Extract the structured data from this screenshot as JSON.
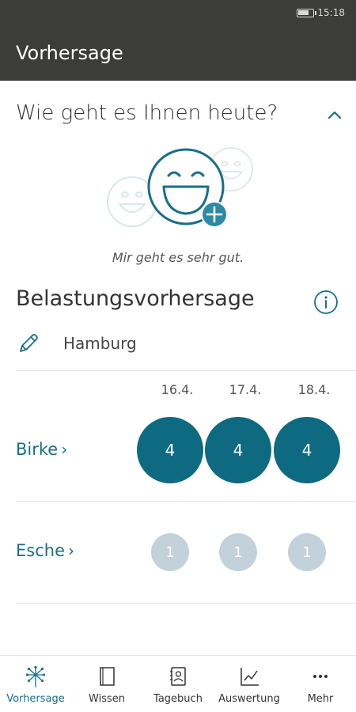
{
  "status_bar": {
    "time": "15:18"
  },
  "app_bar": {
    "title": "Vorhersage"
  },
  "mood": {
    "question": "Wie geht es Ihnen heute?",
    "caption": "Mir geht es sehr gut."
  },
  "forecast": {
    "title": "Belastungsvorhersage",
    "location": "Hamburg",
    "dates": [
      "16.4.",
      "17.4.",
      "18.4."
    ],
    "plants": [
      {
        "name": "Birke",
        "chevron": "›",
        "values": [
          "4",
          "4",
          "4"
        ],
        "level": "high"
      },
      {
        "name": "Esche",
        "chevron": "›",
        "values": [
          "1",
          "1",
          "1"
        ],
        "level": "low"
      }
    ]
  },
  "colors": {
    "accent": "#196e8a",
    "high": "#0d6a81",
    "low": "#c3d1da",
    "appbar": "#3c3c3a"
  },
  "nav": {
    "items": [
      {
        "label": "Vorhersage",
        "icon": "dandelion-icon",
        "active": true
      },
      {
        "label": "Wissen",
        "icon": "book-icon",
        "active": false
      },
      {
        "label": "Tagebuch",
        "icon": "diary-icon",
        "active": false
      },
      {
        "label": "Auswertung",
        "icon": "chart-icon",
        "active": false
      },
      {
        "label": "Mehr",
        "icon": "more-icon",
        "active": false
      }
    ]
  }
}
